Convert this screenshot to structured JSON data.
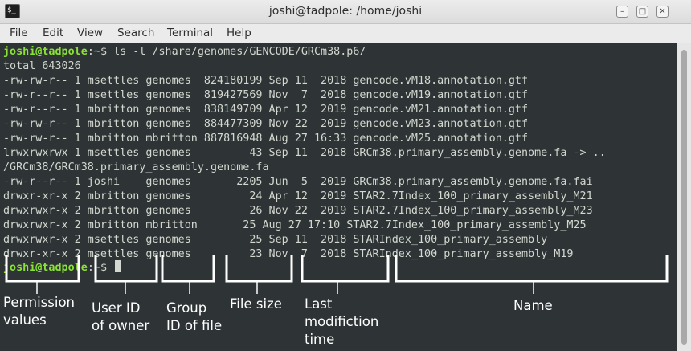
{
  "window": {
    "title": "joshi@tadpole: /home/joshi",
    "icon_glyph": "$_",
    "buttons": {
      "minimize": "–",
      "maximize": "□",
      "close": "✕"
    }
  },
  "menu": [
    "File",
    "Edit",
    "View",
    "Search",
    "Terminal",
    "Help"
  ],
  "prompt": {
    "user_host": "joshi@tadpole",
    "sep": ":",
    "path": "~",
    "symbol": "$ "
  },
  "command": "ls -l /share/genomes/GENCODE/GRCm38.p6/",
  "output": [
    "total 643026",
    "-rw-rw-r-- 1 msettles genomes  824180199 Sep 11  2018 gencode.vM18.annotation.gtf",
    "-rw-r--r-- 1 msettles genomes  819427569 Nov  7  2018 gencode.vM19.annotation.gtf",
    "-rw-r--r-- 1 mbritton genomes  838149709 Apr 12  2019 gencode.vM21.annotation.gtf",
    "-rw-rw-r-- 1 mbritton genomes  884477309 Nov 22  2019 gencode.vM23.annotation.gtf",
    "-rw-rw-r-- 1 mbritton mbritton 887816948 Aug 27 16:33 gencode.vM25.annotation.gtf",
    "lrwxrwxrwx 1 msettles genomes         43 Sep 11  2018 GRCm38.primary_assembly.genome.fa -> ..",
    "/GRCm38/GRCm38.primary_assembly.genome.fa",
    "-rw-r--r-- 1 joshi    genomes       2205 Jun  5  2019 GRCm38.primary_assembly.genome.fa.fai",
    "drwxr-xr-x 2 mbritton genomes         24 Apr 12  2019 STAR2.7Index_100_primary_assembly_M21",
    "drwxrwxr-x 2 mbritton genomes         26 Nov 22  2019 STAR2.7Index_100_primary_assembly_M23",
    "drwxrwxr-x 2 mbritton mbritton       25 Aug 27 17:10 STAR2.7Index_100_primary_assembly_M25",
    "drwxrwxr-x 2 msettles genomes         25 Sep 11  2018 STARIndex_100_primary_assembly",
    "drwxr-xr-x 2 msettles genomes         23 Nov  7  2018 STARIndex_100_primary_assembly_M19"
  ],
  "annotations": {
    "permission": "Permission\nvalues",
    "owner": "User ID\nof owner",
    "group": "Group\nID of file",
    "size": "File size",
    "modified": "Last\nmodifiction\ntime",
    "name": "Name"
  },
  "colors": {
    "prompt_user": "#8ae234",
    "prompt_path": "#729fcf",
    "background": "#2e3436",
    "text": "#d3d7cf",
    "annotation": "#ffffff"
  }
}
